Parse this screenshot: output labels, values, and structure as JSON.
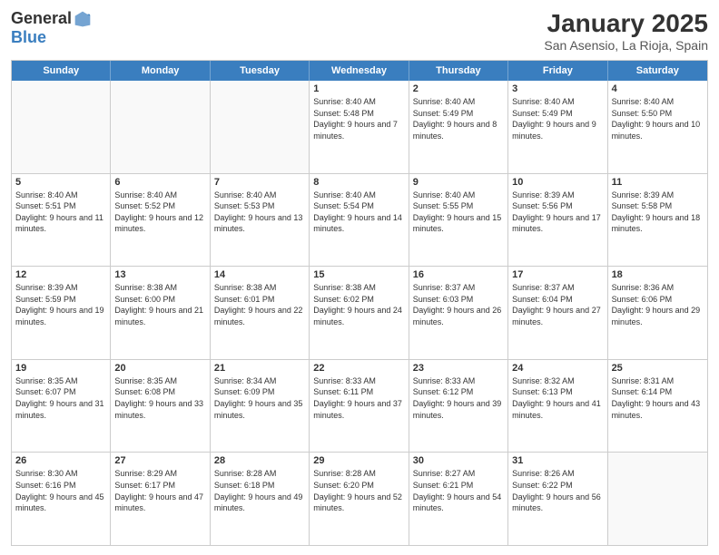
{
  "logo": {
    "general": "General",
    "blue": "Blue"
  },
  "title": "January 2025",
  "location": "San Asensio, La Rioja, Spain",
  "days": [
    "Sunday",
    "Monday",
    "Tuesday",
    "Wednesday",
    "Thursday",
    "Friday",
    "Saturday"
  ],
  "weeks": [
    [
      {
        "day": "",
        "info": ""
      },
      {
        "day": "",
        "info": ""
      },
      {
        "day": "",
        "info": ""
      },
      {
        "day": "1",
        "info": "Sunrise: 8:40 AM\nSunset: 5:48 PM\nDaylight: 9 hours\nand 7 minutes."
      },
      {
        "day": "2",
        "info": "Sunrise: 8:40 AM\nSunset: 5:49 PM\nDaylight: 9 hours\nand 8 minutes."
      },
      {
        "day": "3",
        "info": "Sunrise: 8:40 AM\nSunset: 5:49 PM\nDaylight: 9 hours\nand 9 minutes."
      },
      {
        "day": "4",
        "info": "Sunrise: 8:40 AM\nSunset: 5:50 PM\nDaylight: 9 hours\nand 10 minutes."
      }
    ],
    [
      {
        "day": "5",
        "info": "Sunrise: 8:40 AM\nSunset: 5:51 PM\nDaylight: 9 hours\nand 11 minutes."
      },
      {
        "day": "6",
        "info": "Sunrise: 8:40 AM\nSunset: 5:52 PM\nDaylight: 9 hours\nand 12 minutes."
      },
      {
        "day": "7",
        "info": "Sunrise: 8:40 AM\nSunset: 5:53 PM\nDaylight: 9 hours\nand 13 minutes."
      },
      {
        "day": "8",
        "info": "Sunrise: 8:40 AM\nSunset: 5:54 PM\nDaylight: 9 hours\nand 14 minutes."
      },
      {
        "day": "9",
        "info": "Sunrise: 8:40 AM\nSunset: 5:55 PM\nDaylight: 9 hours\nand 15 minutes."
      },
      {
        "day": "10",
        "info": "Sunrise: 8:39 AM\nSunset: 5:56 PM\nDaylight: 9 hours\nand 17 minutes."
      },
      {
        "day": "11",
        "info": "Sunrise: 8:39 AM\nSunset: 5:58 PM\nDaylight: 9 hours\nand 18 minutes."
      }
    ],
    [
      {
        "day": "12",
        "info": "Sunrise: 8:39 AM\nSunset: 5:59 PM\nDaylight: 9 hours\nand 19 minutes."
      },
      {
        "day": "13",
        "info": "Sunrise: 8:38 AM\nSunset: 6:00 PM\nDaylight: 9 hours\nand 21 minutes."
      },
      {
        "day": "14",
        "info": "Sunrise: 8:38 AM\nSunset: 6:01 PM\nDaylight: 9 hours\nand 22 minutes."
      },
      {
        "day": "15",
        "info": "Sunrise: 8:38 AM\nSunset: 6:02 PM\nDaylight: 9 hours\nand 24 minutes."
      },
      {
        "day": "16",
        "info": "Sunrise: 8:37 AM\nSunset: 6:03 PM\nDaylight: 9 hours\nand 26 minutes."
      },
      {
        "day": "17",
        "info": "Sunrise: 8:37 AM\nSunset: 6:04 PM\nDaylight: 9 hours\nand 27 minutes."
      },
      {
        "day": "18",
        "info": "Sunrise: 8:36 AM\nSunset: 6:06 PM\nDaylight: 9 hours\nand 29 minutes."
      }
    ],
    [
      {
        "day": "19",
        "info": "Sunrise: 8:35 AM\nSunset: 6:07 PM\nDaylight: 9 hours\nand 31 minutes."
      },
      {
        "day": "20",
        "info": "Sunrise: 8:35 AM\nSunset: 6:08 PM\nDaylight: 9 hours\nand 33 minutes."
      },
      {
        "day": "21",
        "info": "Sunrise: 8:34 AM\nSunset: 6:09 PM\nDaylight: 9 hours\nand 35 minutes."
      },
      {
        "day": "22",
        "info": "Sunrise: 8:33 AM\nSunset: 6:11 PM\nDaylight: 9 hours\nand 37 minutes."
      },
      {
        "day": "23",
        "info": "Sunrise: 8:33 AM\nSunset: 6:12 PM\nDaylight: 9 hours\nand 39 minutes."
      },
      {
        "day": "24",
        "info": "Sunrise: 8:32 AM\nSunset: 6:13 PM\nDaylight: 9 hours\nand 41 minutes."
      },
      {
        "day": "25",
        "info": "Sunrise: 8:31 AM\nSunset: 6:14 PM\nDaylight: 9 hours\nand 43 minutes."
      }
    ],
    [
      {
        "day": "26",
        "info": "Sunrise: 8:30 AM\nSunset: 6:16 PM\nDaylight: 9 hours\nand 45 minutes."
      },
      {
        "day": "27",
        "info": "Sunrise: 8:29 AM\nSunset: 6:17 PM\nDaylight: 9 hours\nand 47 minutes."
      },
      {
        "day": "28",
        "info": "Sunrise: 8:28 AM\nSunset: 6:18 PM\nDaylight: 9 hours\nand 49 minutes."
      },
      {
        "day": "29",
        "info": "Sunrise: 8:28 AM\nSunset: 6:20 PM\nDaylight: 9 hours\nand 52 minutes."
      },
      {
        "day": "30",
        "info": "Sunrise: 8:27 AM\nSunset: 6:21 PM\nDaylight: 9 hours\nand 54 minutes."
      },
      {
        "day": "31",
        "info": "Sunrise: 8:26 AM\nSunset: 6:22 PM\nDaylight: 9 hours\nand 56 minutes."
      },
      {
        "day": "",
        "info": ""
      }
    ]
  ]
}
